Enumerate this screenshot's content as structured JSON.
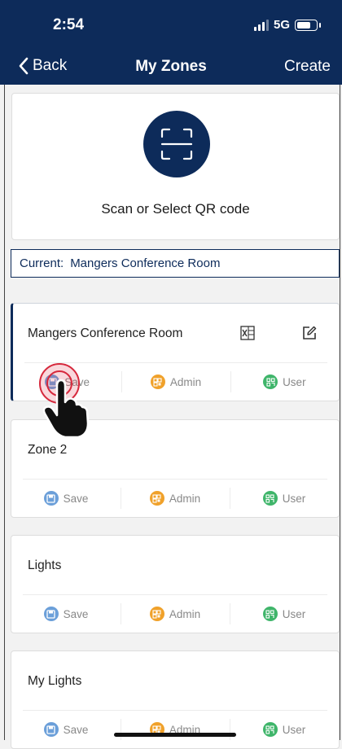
{
  "status": {
    "time": "2:54",
    "network": "5G"
  },
  "nav": {
    "back_label": "Back",
    "title": "My Zones",
    "create_label": "Create"
  },
  "scan": {
    "label": "Scan or Select QR code"
  },
  "current": {
    "label": "Current:",
    "value": "Mangers Conference Room"
  },
  "actions": {
    "save": "Save",
    "admin": "Admin",
    "user": "User"
  },
  "zones": [
    {
      "name": "Mangers Conference Room"
    },
    {
      "name": "Zone 2"
    },
    {
      "name": "Lights"
    },
    {
      "name": "My Lights"
    }
  ],
  "colors": {
    "header": "#0d2b5a",
    "save_icon": "#6b9fd9",
    "admin_icon": "#f0a12a",
    "user_icon": "#3fb56a"
  },
  "icons": [
    "back-chevron-icon",
    "scan-qr-icon",
    "excel-icon",
    "edit-icon",
    "save-icon",
    "admin-icon",
    "user-icon",
    "tap-hand-icon"
  ]
}
